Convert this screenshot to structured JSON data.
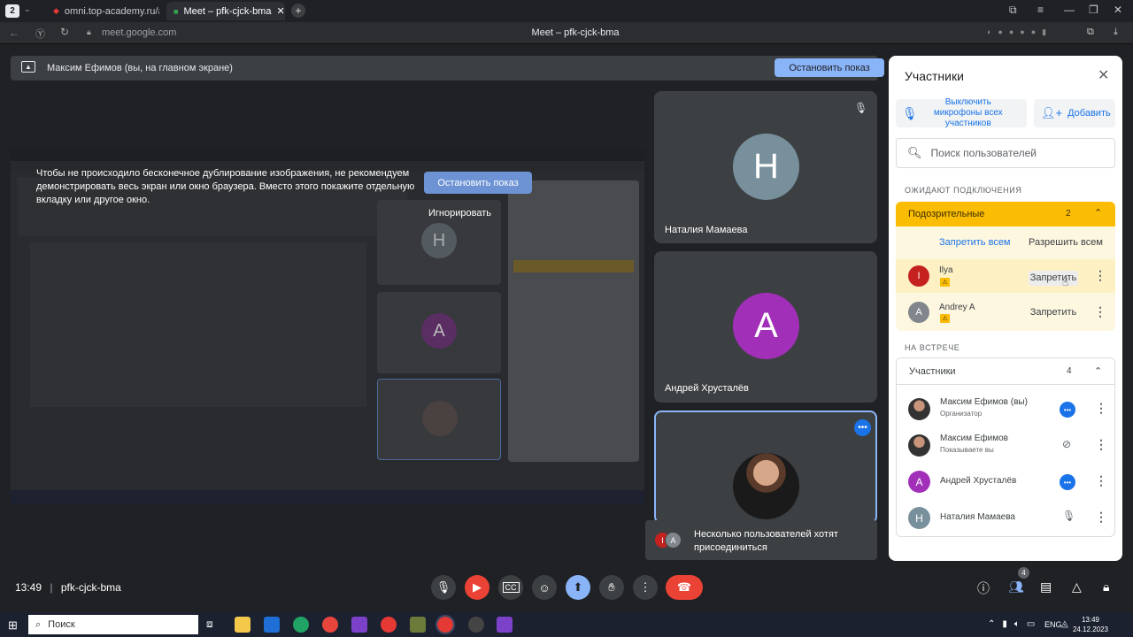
{
  "browser": {
    "tab_count": "2",
    "tabs": [
      {
        "label": "omni.top-academy.ru/#/pr"
      },
      {
        "label": "Meet – pfk-cjck-bma"
      }
    ],
    "url": "meet.google.com",
    "page_title": "Meet – pfk-cjck-bma"
  },
  "meet": {
    "banner_text": "Максим Ефимов (вы, на главном экране)",
    "stop_share_label": "Остановить показ",
    "presentation": {
      "warning": "Чтобы не происходило бесконечное дублирование изображения, не рекомендуем демонстрировать весь экран или окно браузера. Вместо этого покажите отдельную вкладку или другое окно.",
      "stop_label": "Остановить показ",
      "ignore_label": "Игнорировать"
    },
    "tiles": [
      {
        "initial": "Н",
        "name": "Наталия Мамаева",
        "color": "#78909c"
      },
      {
        "initial": "А",
        "name": "Андрей Хрусталёв",
        "color": "#a12fb8"
      }
    ],
    "toast": "Несколько пользователей хотят присоединиться",
    "time": "13:49",
    "meeting_code": "pfk-cjck-bma",
    "people_badge": "4"
  },
  "panel": {
    "title": "Участники",
    "mute_all": "Выключить микрофоны всех участников",
    "add": "Добавить",
    "search_placeholder": "Поиск пользователей",
    "waiting_header": "ОЖИДАЮТ ПОДКЛЮЧЕНИЯ",
    "suspicious_label": "Подозрительные",
    "suspicious_count": "2",
    "deny_all": "Запретить всем",
    "allow_all": "Разрешить всем",
    "waiting": [
      {
        "initial": "I",
        "name": "Ilya",
        "action": "Запретить",
        "color": "#c5221f"
      },
      {
        "initial": "A",
        "name": "Andrey A",
        "action": "Запретить",
        "color": "#80868b"
      }
    ],
    "in_meeting_header": "НА ВСТРЕЧЕ",
    "participants_label": "Участники",
    "participants_count": "4",
    "participants": [
      {
        "name": "Максим Ефимов (вы)",
        "role": "Организатор"
      },
      {
        "name": "Максим Ефимов",
        "role": "Показываете вы"
      },
      {
        "initial": "А",
        "name": "Андрей Хрусталёв",
        "color": "#a12fb8"
      },
      {
        "initial": "Н",
        "name": "Наталия Мамаева",
        "color": "#78909c"
      }
    ]
  },
  "taskbar": {
    "search": "Поиск",
    "lang": "ENG",
    "time": "13:49",
    "date": "24.12.2023"
  }
}
